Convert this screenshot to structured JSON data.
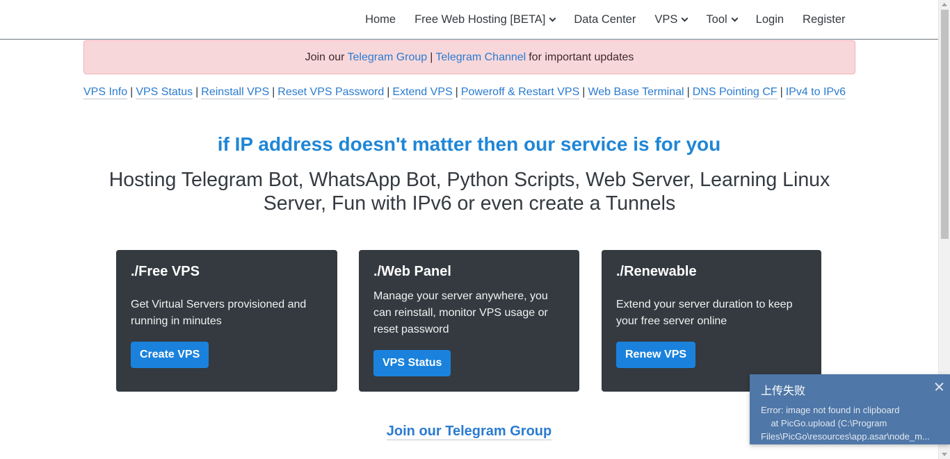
{
  "nav": {
    "items": [
      {
        "label": "Home",
        "dropdown": false
      },
      {
        "label": "Free Web Hosting [BETA]",
        "dropdown": true
      },
      {
        "label": "Data Center",
        "dropdown": false
      },
      {
        "label": "VPS",
        "dropdown": true
      },
      {
        "label": "Tool",
        "dropdown": true
      },
      {
        "label": "Login",
        "dropdown": false
      },
      {
        "label": "Register",
        "dropdown": false
      }
    ]
  },
  "alert": {
    "prefix": "Join our",
    "link1": "Telegram Group",
    "separator": "|",
    "link2": "Telegram Channel",
    "suffix": "for important updates"
  },
  "quick_links": [
    "VPS Info",
    "VPS Status",
    "Reinstall VPS",
    "Reset VPS Password",
    "Extend VPS",
    "Poweroff & Restart VPS",
    "Web Base Terminal",
    "DNS Pointing CF",
    "IPv4 to IPv6"
  ],
  "hero": {
    "title": "if IP address doesn't matter then our service is for you",
    "subtitle": "Hosting Telegram Bot, WhatsApp Bot, Python Scripts, Web Server, Learning Linux Server, Fun with IPv6 or even create a Tunnels"
  },
  "cards": [
    {
      "title": "./Free VPS",
      "text": "Get Virtual Servers provisioned and running in minutes",
      "button": "Create VPS"
    },
    {
      "title": "./Web Panel",
      "text": "Manage your server anywhere, you can reinstall, monitor VPS usage or reset password",
      "button": "VPS Status"
    },
    {
      "title": "./Renewable",
      "text": "Extend your server duration to keep your free server online",
      "button": "Renew VPS"
    }
  ],
  "bottom_link": "Join our Telegram Group",
  "toast": {
    "title": "上传失败",
    "body": "Error: image not found in clipboard\n    at PicGo.upload (C:\\Program\nFiles\\PicGo\\resources\\app.asar\\node_m..."
  },
  "colors": {
    "link": "#2a7bd0",
    "hero_title": "#1f86d6",
    "card_bg": "#343a40",
    "button_bg": "#1a82dc",
    "alert_bg": "#f8d7da",
    "toast_bg": "#4f77a8"
  }
}
